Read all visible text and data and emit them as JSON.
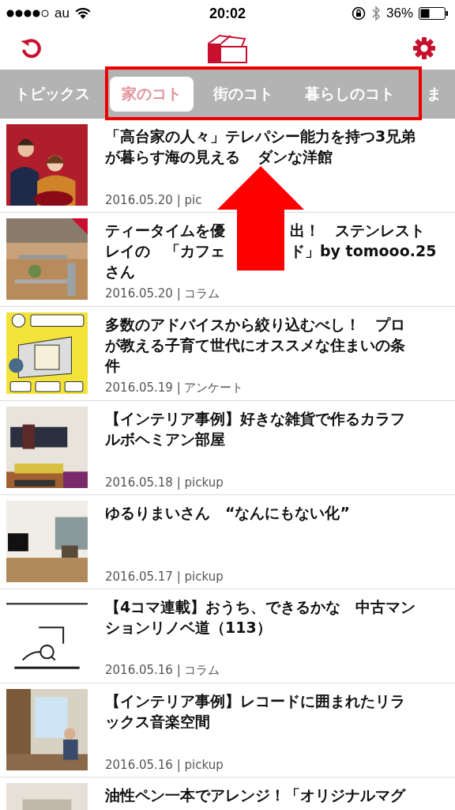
{
  "status_bar": {
    "carrier": "au",
    "time": "20:02",
    "battery": "36%"
  },
  "tabs": [
    {
      "label": "トピックス",
      "selected": false
    },
    {
      "label": "家のコト",
      "selected": true
    },
    {
      "label": "街のコト",
      "selected": false
    },
    {
      "label": "暮らしのコト",
      "selected": false
    },
    {
      "label": "ま",
      "selected": false
    }
  ],
  "articles": [
    {
      "title_lines": [
        [
          "「高台家の人々」テレパシー能力を持つ3兄弟"
        ],
        [
          "が暮らす海の見える",
          "ダンな洋館"
        ]
      ],
      "meta": "2016.05.20 | pic"
    },
    {
      "title_lines": [
        [
          "ティータイムを優",
          "出！　ステンレスト"
        ],
        [
          "レイの　「カフェ",
          "ド」by tomooo.25"
        ],
        [
          "さん"
        ]
      ],
      "meta": "2016.05.20 | コラム"
    },
    {
      "title_lines": [
        [
          "多数のアドバイスから絞り込むべし！　プロ"
        ],
        [
          "が教える子育て世代にオススメな住まいの条"
        ],
        [
          "件"
        ]
      ],
      "meta": "2016.05.19 | アンケート"
    },
    {
      "title_lines": [
        [
          "【インテリア事例】好きな雑貨で作るカラフ"
        ],
        [
          "ルボヘミアン部屋"
        ]
      ],
      "meta": "2016.05.18 | pickup"
    },
    {
      "title_lines": [
        [
          "ゆるりまいさん　“なんにもない化”"
        ]
      ],
      "meta": "2016.05.17 | pickup"
    },
    {
      "title_lines": [
        [
          "【4コマ連載】おうち、できるかな　中古マン"
        ],
        [
          "ションリノベ道（113）"
        ]
      ],
      "meta": "2016.05.16 | コラム"
    },
    {
      "title_lines": [
        [
          "【インテリア事例】レコードに囲まれたリラ"
        ],
        [
          "ックス音楽空間"
        ]
      ],
      "meta": "2016.05.16 | pickup"
    },
    {
      "title_lines": [
        [
          "油性ペン一本でアレンジ！「オリジナルマグ"
        ]
      ]
    }
  ]
}
